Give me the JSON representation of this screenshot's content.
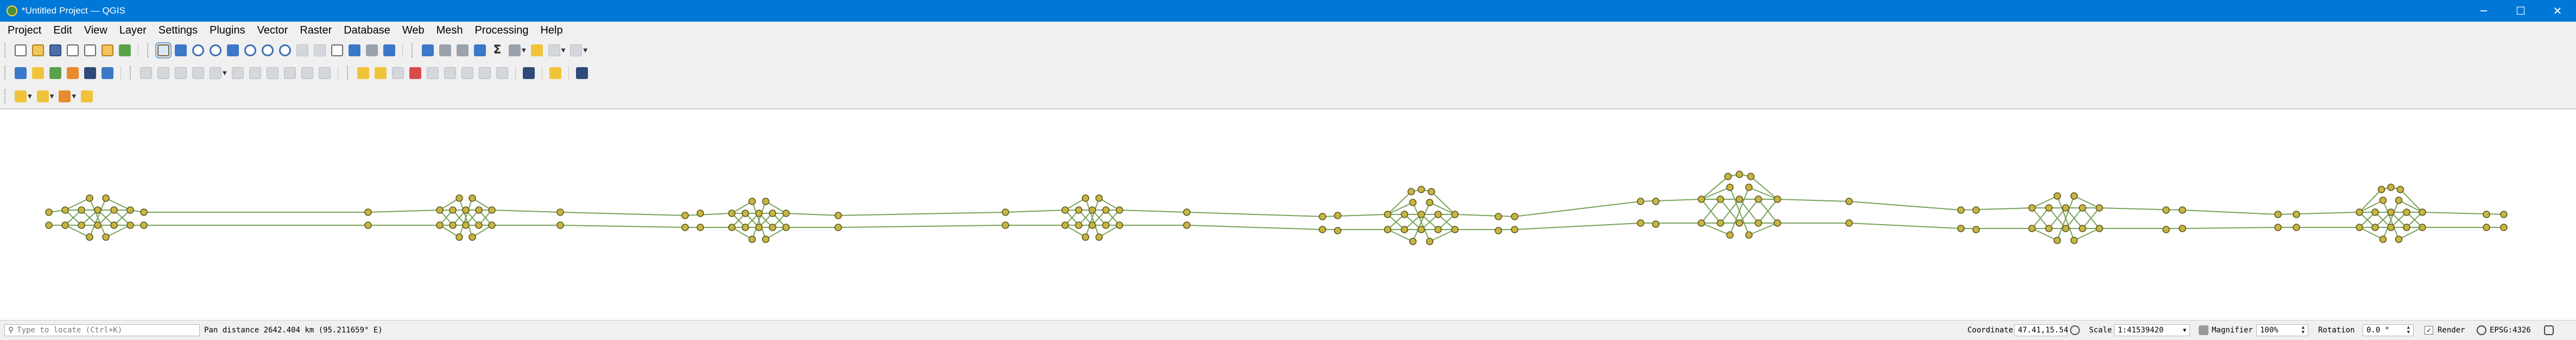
{
  "window": {
    "title": "*Untitled Project — QGIS",
    "minimize": "─",
    "maximize": "☐",
    "close": "✕"
  },
  "menu": [
    "Project",
    "Edit",
    "View",
    "Layer",
    "Settings",
    "Plugins",
    "Vector",
    "Raster",
    "Database",
    "Web",
    "Mesh",
    "Processing",
    "Help"
  ],
  "toolbars": {
    "sigma_glyph": "Σ"
  },
  "map": {
    "line_color": "#7aa35a",
    "node_fill": "#c9b544",
    "node_stroke": "#5c5a1e"
  },
  "status": {
    "locate_placeholder": "Type to locate (Ctrl+K)",
    "message": "Pan distance 2642.404 km (95.211659° E)",
    "coordinate_label": "Coordinate",
    "coordinate_value": "47.41,15.54",
    "scale_label": "Scale",
    "scale_value": "1:41539420",
    "magnifier_label": "Magnifier",
    "magnifier_value": "100%",
    "rotation_label": "Rotation",
    "rotation_value": "0.0 °",
    "render_label": "Render",
    "render_checked": true,
    "crs": "EPSG:4326"
  }
}
